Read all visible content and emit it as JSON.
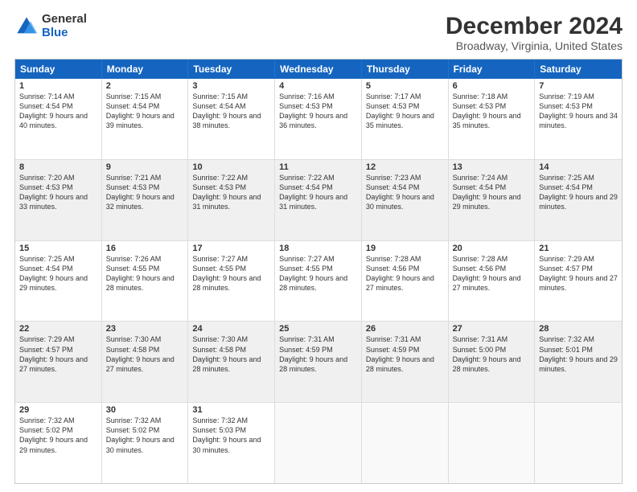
{
  "logo": {
    "line1": "General",
    "line2": "Blue"
  },
  "title": "December 2024",
  "subtitle": "Broadway, Virginia, United States",
  "days": [
    "Sunday",
    "Monday",
    "Tuesday",
    "Wednesday",
    "Thursday",
    "Friday",
    "Saturday"
  ],
  "rows": [
    [
      {
        "day": "1",
        "text": "Sunrise: 7:14 AM\nSunset: 4:54 PM\nDaylight: 9 hours and 40 minutes."
      },
      {
        "day": "2",
        "text": "Sunrise: 7:15 AM\nSunset: 4:54 PM\nDaylight: 9 hours and 39 minutes."
      },
      {
        "day": "3",
        "text": "Sunrise: 7:15 AM\nSunset: 4:54 AM\nDaylight: 9 hours and 38 minutes."
      },
      {
        "day": "4",
        "text": "Sunrise: 7:16 AM\nSunset: 4:53 PM\nDaylight: 9 hours and 36 minutes."
      },
      {
        "day": "5",
        "text": "Sunrise: 7:17 AM\nSunset: 4:53 PM\nDaylight: 9 hours and 35 minutes."
      },
      {
        "day": "6",
        "text": "Sunrise: 7:18 AM\nSunset: 4:53 PM\nDaylight: 9 hours and 35 minutes."
      },
      {
        "day": "7",
        "text": "Sunrise: 7:19 AM\nSunset: 4:53 PM\nDaylight: 9 hours and 34 minutes."
      }
    ],
    [
      {
        "day": "8",
        "text": "Sunrise: 7:20 AM\nSunset: 4:53 PM\nDaylight: 9 hours and 33 minutes."
      },
      {
        "day": "9",
        "text": "Sunrise: 7:21 AM\nSunset: 4:53 PM\nDaylight: 9 hours and 32 minutes."
      },
      {
        "day": "10",
        "text": "Sunrise: 7:22 AM\nSunset: 4:53 PM\nDaylight: 9 hours and 31 minutes."
      },
      {
        "day": "11",
        "text": "Sunrise: 7:22 AM\nSunset: 4:54 PM\nDaylight: 9 hours and 31 minutes."
      },
      {
        "day": "12",
        "text": "Sunrise: 7:23 AM\nSunset: 4:54 PM\nDaylight: 9 hours and 30 minutes."
      },
      {
        "day": "13",
        "text": "Sunrise: 7:24 AM\nSunset: 4:54 PM\nDaylight: 9 hours and 29 minutes."
      },
      {
        "day": "14",
        "text": "Sunrise: 7:25 AM\nSunset: 4:54 PM\nDaylight: 9 hours and 29 minutes."
      }
    ],
    [
      {
        "day": "15",
        "text": "Sunrise: 7:25 AM\nSunset: 4:54 PM\nDaylight: 9 hours and 29 minutes."
      },
      {
        "day": "16",
        "text": "Sunrise: 7:26 AM\nSunset: 4:55 PM\nDaylight: 9 hours and 28 minutes."
      },
      {
        "day": "17",
        "text": "Sunrise: 7:27 AM\nSunset: 4:55 PM\nDaylight: 9 hours and 28 minutes."
      },
      {
        "day": "18",
        "text": "Sunrise: 7:27 AM\nSunset: 4:55 PM\nDaylight: 9 hours and 28 minutes."
      },
      {
        "day": "19",
        "text": "Sunrise: 7:28 AM\nSunset: 4:56 PM\nDaylight: 9 hours and 27 minutes."
      },
      {
        "day": "20",
        "text": "Sunrise: 7:28 AM\nSunset: 4:56 PM\nDaylight: 9 hours and 27 minutes."
      },
      {
        "day": "21",
        "text": "Sunrise: 7:29 AM\nSunset: 4:57 PM\nDaylight: 9 hours and 27 minutes."
      }
    ],
    [
      {
        "day": "22",
        "text": "Sunrise: 7:29 AM\nSunset: 4:57 PM\nDaylight: 9 hours and 27 minutes."
      },
      {
        "day": "23",
        "text": "Sunrise: 7:30 AM\nSunset: 4:58 PM\nDaylight: 9 hours and 27 minutes."
      },
      {
        "day": "24",
        "text": "Sunrise: 7:30 AM\nSunset: 4:58 PM\nDaylight: 9 hours and 28 minutes."
      },
      {
        "day": "25",
        "text": "Sunrise: 7:31 AM\nSunset: 4:59 PM\nDaylight: 9 hours and 28 minutes."
      },
      {
        "day": "26",
        "text": "Sunrise: 7:31 AM\nSunset: 4:59 PM\nDaylight: 9 hours and 28 minutes."
      },
      {
        "day": "27",
        "text": "Sunrise: 7:31 AM\nSunset: 5:00 PM\nDaylight: 9 hours and 28 minutes."
      },
      {
        "day": "28",
        "text": "Sunrise: 7:32 AM\nSunset: 5:01 PM\nDaylight: 9 hours and 29 minutes."
      }
    ],
    [
      {
        "day": "29",
        "text": "Sunrise: 7:32 AM\nSunset: 5:02 PM\nDaylight: 9 hours and 29 minutes."
      },
      {
        "day": "30",
        "text": "Sunrise: 7:32 AM\nSunset: 5:02 PM\nDaylight: 9 hours and 30 minutes."
      },
      {
        "day": "31",
        "text": "Sunrise: 7:32 AM\nSunset: 5:03 PM\nDaylight: 9 hours and 30 minutes."
      },
      {
        "day": "",
        "text": ""
      },
      {
        "day": "",
        "text": ""
      },
      {
        "day": "",
        "text": ""
      },
      {
        "day": "",
        "text": ""
      }
    ]
  ]
}
